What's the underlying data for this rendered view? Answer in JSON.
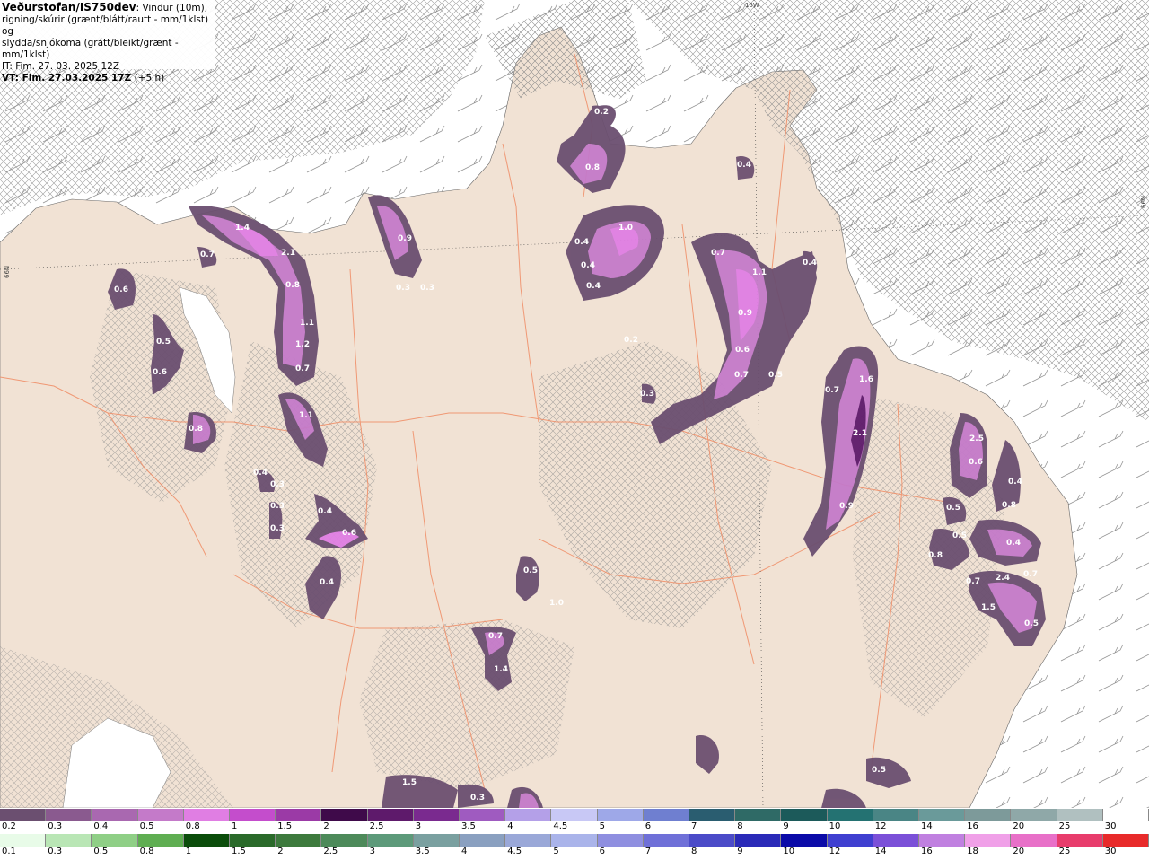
{
  "header": {
    "title_strong": "Veðurstofan/IS750dev",
    "title_rest": ": Vindur (10m),",
    "line2": "rigning/skúrir (grænt/blátt/rautt - mm/1klst) og",
    "line3": "slydda/snjókoma (grátt/bleikt/grænt - mm/1klst)",
    "line4": "IT: Fim. 27. 03. 2025 12Z",
    "line5_strong": "VT: Fim. 27.03.2025 17Z",
    "line5_rest": " (+5 h)"
  },
  "coords": {
    "top": "15W",
    "left": "66N",
    "right": "66N"
  },
  "colors": {
    "land": "#f1e2d4",
    "sea": "#ffffff",
    "roads": "#f0906a",
    "hatch": "#8a8a8a"
  },
  "precip_values": [
    "0.2",
    "0.8",
    "0.4",
    "1.0",
    "0.4",
    "0.4",
    "0.4",
    "0.7",
    "1.1",
    "0.9",
    "0.6",
    "0.7",
    "0.5",
    "0.4",
    "1.6",
    "2.1",
    "0.9",
    "0.7",
    "1.4",
    "2.1",
    "0.8",
    "1.1",
    "1.2",
    "0.7",
    "1.1",
    "0.9",
    "0.3",
    "0.3",
    "0.7",
    "0.6",
    "0.5",
    "0.6",
    "0.8",
    "0.3",
    "0.2",
    "0.4",
    "0.3",
    "0.3",
    "0.3",
    "0.6",
    "0.4",
    "0.4",
    "0.5",
    "1.0",
    "0.7",
    "1.4",
    "2.5",
    "0.6",
    "0.4",
    "0.8",
    "0.5",
    "2.4",
    "0.5",
    "0.4",
    "0.8",
    "0.7",
    "0.7",
    "1.5",
    "0.5",
    "1.5",
    "0.5",
    "0.3"
  ],
  "legend_snow": {
    "labels": [
      "0.2",
      "0.3",
      "0.4",
      "0.5",
      "0.8",
      "1",
      "1.5",
      "2",
      "2.5",
      "3",
      "3.5",
      "4",
      "4.5",
      "5",
      "6",
      "7",
      "8",
      "9",
      "10",
      "12",
      "14",
      "16",
      "20",
      "25",
      "30"
    ],
    "colors": [
      "#6b4f70",
      "#8a5a8f",
      "#a968b0",
      "#c47ac9",
      "#e07ee3",
      "#c44dcc",
      "#9b3aa6",
      "#3f0a4a",
      "#5e1a6b",
      "#7a2a8f",
      "#9f5bc0",
      "#b4a0e8",
      "#c8c8f5",
      "#9ea8e8",
      "#6f7fd0",
      "#2a5d70",
      "#2f6a66",
      "#1c5a5a",
      "#247272",
      "#4a8585",
      "#6a9a9a",
      "#7d9a9a",
      "#8fa8a8",
      "#b0c0c0",
      "#ffffff"
    ]
  },
  "legend_rain": {
    "labels": [
      "0.1",
      "0.3",
      "0.5",
      "0.8",
      "1",
      "1.5",
      "2",
      "2.5",
      "3",
      "3.5",
      "4",
      "4.5",
      "5",
      "6",
      "7",
      "8",
      "9",
      "10",
      "12",
      "14",
      "16",
      "18",
      "20",
      "25",
      "30"
    ],
    "colors": [
      "#e8fbe8",
      "#b9e6b5",
      "#8fcf86",
      "#5fae52",
      "#0b4d0b",
      "#2a6a2a",
      "#3d7a3d",
      "#4d8a5a",
      "#5d9a7a",
      "#7aa0a0",
      "#8aa0c0",
      "#9aa8d8",
      "#aab4ea",
      "#8f8fe0",
      "#6f70d8",
      "#4b4bc8",
      "#2a2ab8",
      "#0b0ba8",
      "#3f3fd0",
      "#7b50d8",
      "#c080e0",
      "#f0a0e8",
      "#e870c8",
      "#e83c6c",
      "#e82a2a"
    ]
  }
}
